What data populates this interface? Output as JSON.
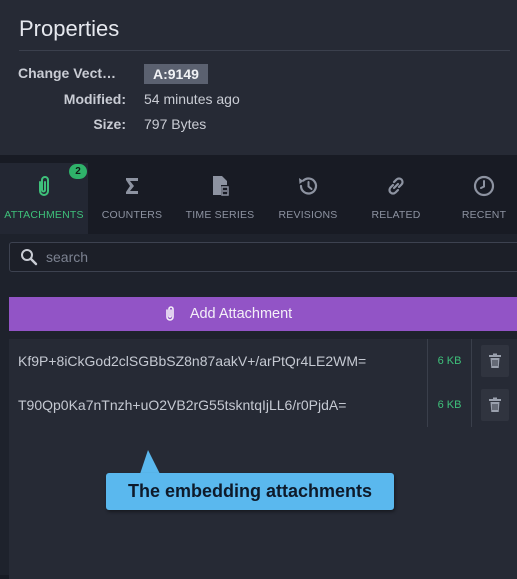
{
  "properties": {
    "title": "Properties",
    "change_vector_label": "Change Vect…",
    "change_vector_value": "A:9149",
    "modified_label": "Modified:",
    "modified_value": "54 minutes ago",
    "size_label": "Size:",
    "size_value": "797 Bytes"
  },
  "tabs": [
    {
      "label": "ATTACHMENTS",
      "icon": "paperclip-icon",
      "active": true,
      "badge": "2"
    },
    {
      "label": "COUNTERS",
      "icon": "sigma-icon",
      "active": false
    },
    {
      "label": "TIME SERIES",
      "icon": "time-series-icon",
      "active": false
    },
    {
      "label": "REVISIONS",
      "icon": "revisions-icon",
      "active": false
    },
    {
      "label": "RELATED",
      "icon": "link-icon",
      "active": false
    },
    {
      "label": "RECENT",
      "icon": "clock-icon",
      "active": false
    }
  ],
  "search": {
    "placeholder": "search",
    "value": ""
  },
  "add_attachment_label": "Add Attachment",
  "attachments": [
    {
      "name": "Kf9P+8iCkGod2clSGBbSZ8n87aakV+/arPtQr4LE2WM=",
      "size": "6 KB"
    },
    {
      "name": "T90Qp0Ka7nTnzh+uO2VB2rG55tskntqIjLL6/r0PjdA=",
      "size": "6 KB"
    }
  ],
  "callout_text": "The embedding attachments",
  "colors": {
    "accent_green": "#3ec07a",
    "button_purple": "#9254c6",
    "callout_blue": "#5ab8ee"
  }
}
